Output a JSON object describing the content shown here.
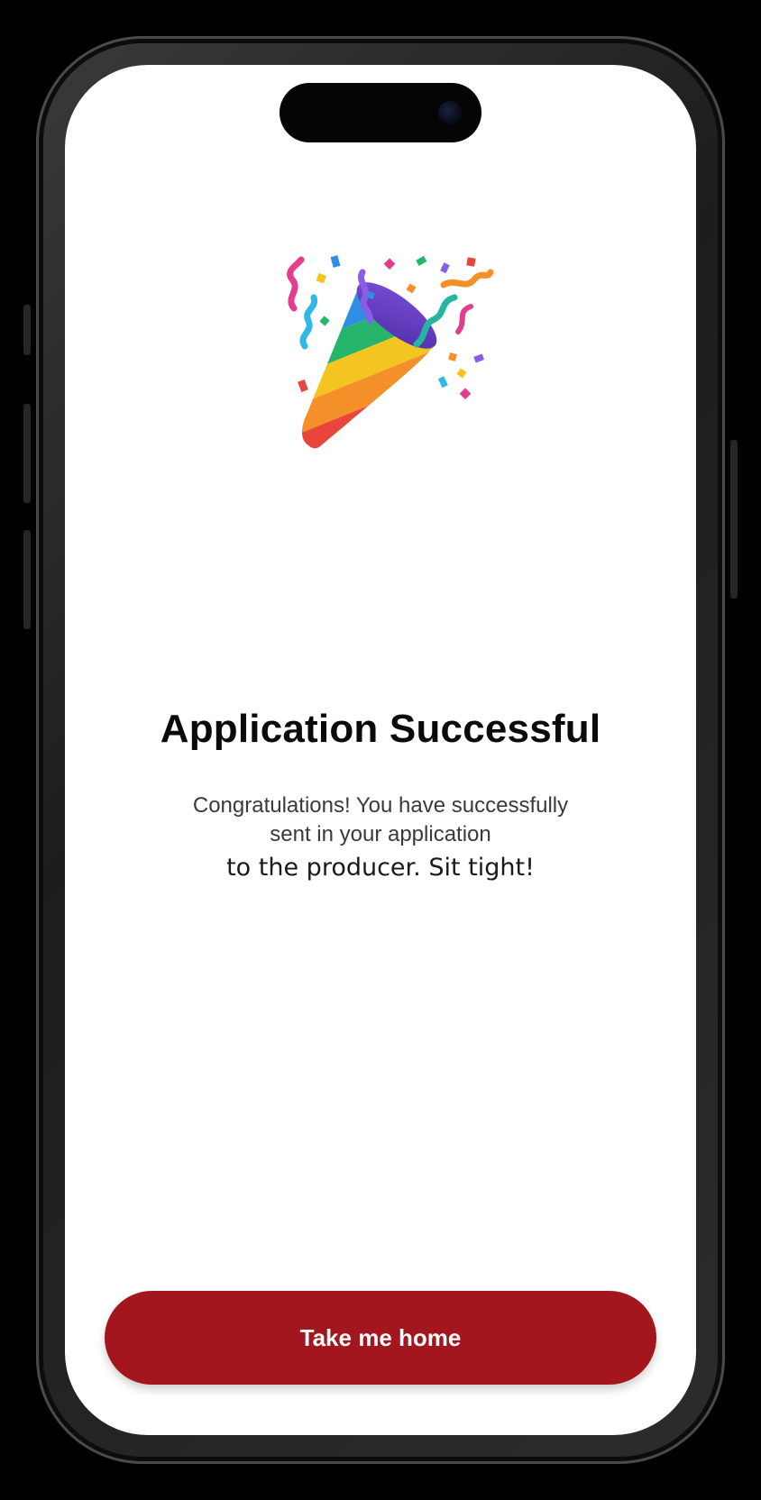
{
  "screen": {
    "celebration_icon": "party-popper-icon",
    "title": "Application Successful",
    "message_line1": "Congratulations! You have successfully sent in your application",
    "message_line2": "to the producer. Sit tight!",
    "button_label": "Take me home"
  },
  "colors": {
    "accent": "#a3161d",
    "background": "#ffffff",
    "title_text": "#0a0a0a",
    "body_text": "#3a3a3a"
  }
}
